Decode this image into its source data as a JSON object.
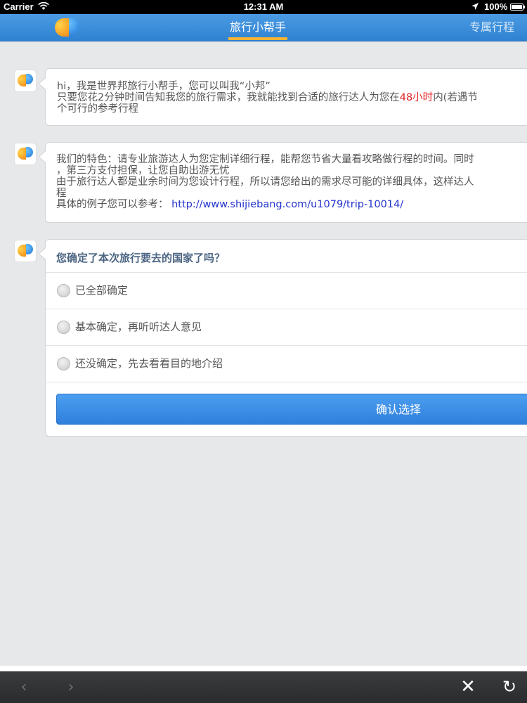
{
  "status_bar": {
    "carrier": "Carrier",
    "time": "12:31 AM",
    "battery": "100%"
  },
  "nav": {
    "title": "旅行小帮手",
    "right_link": "专属行程"
  },
  "messages": [
    {
      "lines": [
        " hi，我是世界邦旅行小帮手，您可以叫我“小邦”",
        "只要您花2分钟时间告知我您的旅行需求，我就能找到合适的旅行达人为您在",
        "48小时",
        "内(若遇节",
        "个可行的参考行程"
      ]
    },
    {
      "lines": [
        "我们的特色：请专业旅游达人为您定制详细行程，能帮您节省大量看攻略做行程的时间。同时",
        "，第三方支付担保，让您自助出游无忧",
        "由于旅行达人都是业余时间为您设计行程，所以请您给出的需求尽可能的详细具体，这样达人",
        "程",
        "具体的例子您可以参考：",
        "http://www.shijiebang.com/u1079/trip-10014/"
      ]
    }
  ],
  "question": {
    "title": "您确定了本次旅行要去的国家了吗？",
    "options": [
      "已全部确定",
      "基本确定，再听听达人意见",
      "还没确定，先去看看目的地介绍"
    ],
    "confirm_label": "确认选择"
  },
  "toolbar": {
    "back": "‹",
    "forward": "›",
    "close": "✕",
    "reload": "↻"
  },
  "colors": {
    "nav_blue": "#3a8cd9",
    "tab_underline": "#f5b335",
    "highlight_red": "#e32424",
    "link_blue": "#2233cc",
    "button_blue": "#3d8fe6"
  }
}
